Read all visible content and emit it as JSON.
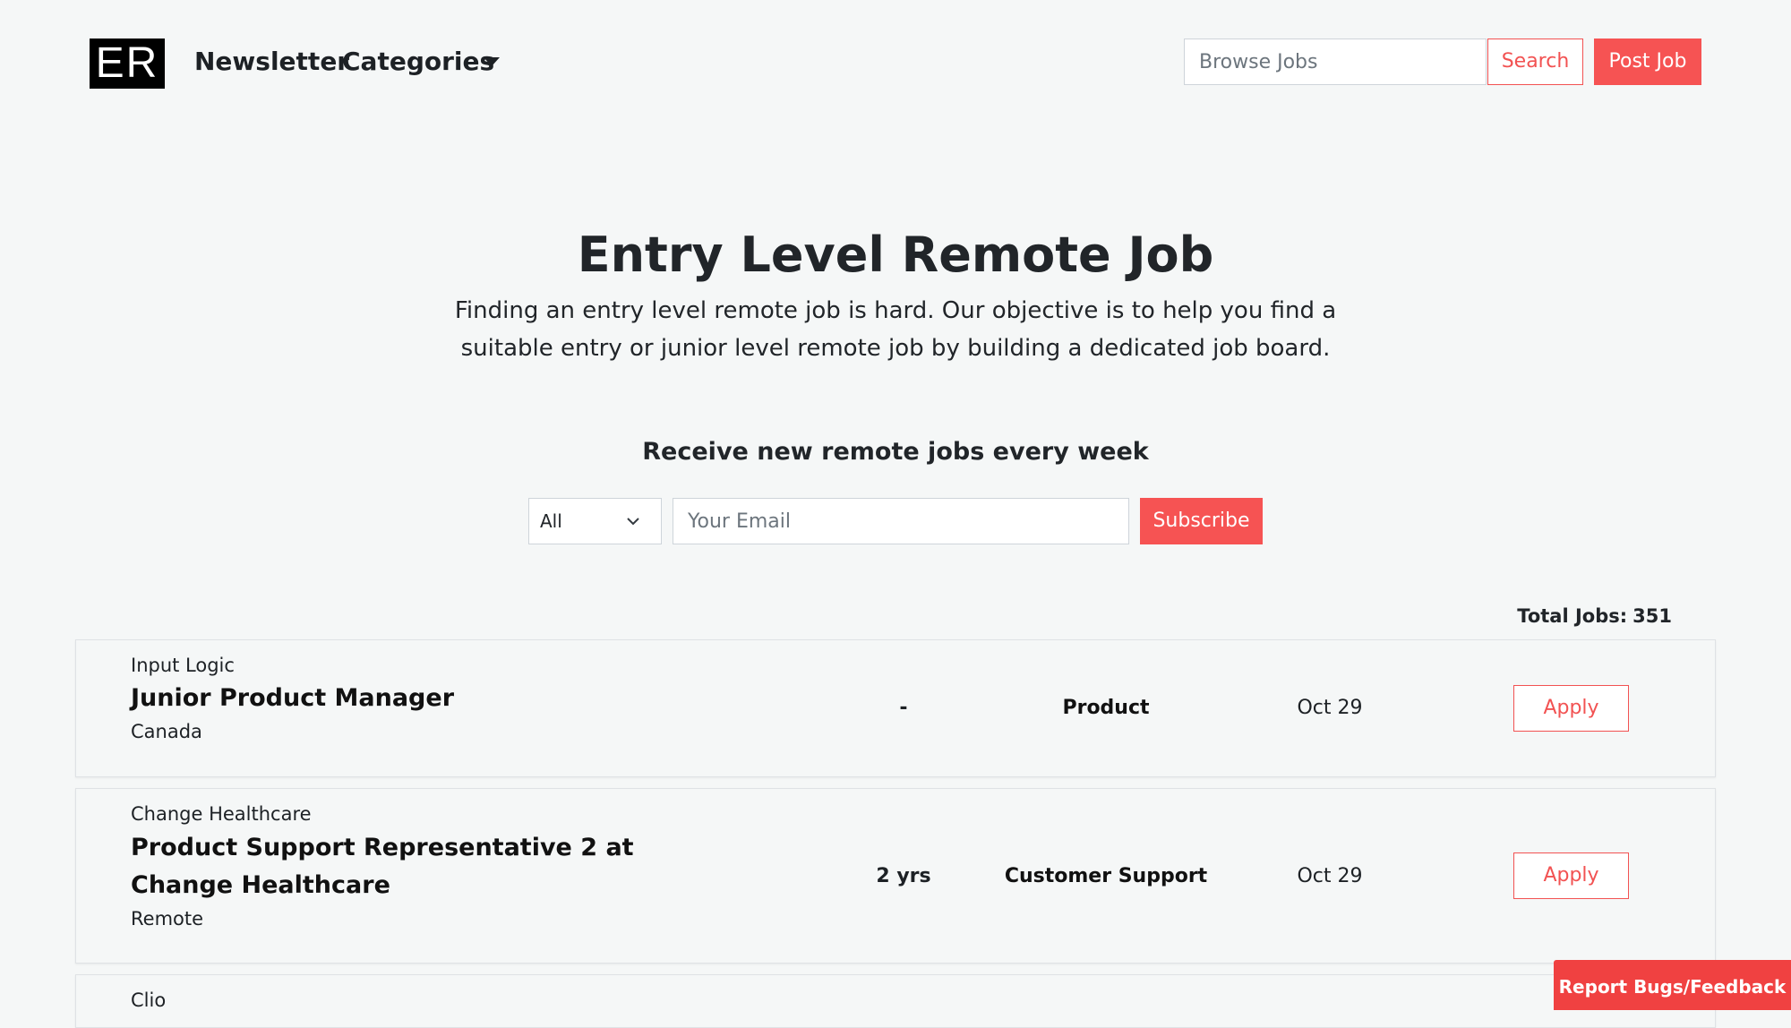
{
  "header": {
    "logo_text": "ER",
    "nav": {
      "newsletter": "Newsletter",
      "categories": "Categories"
    },
    "search": {
      "placeholder": "Browse Jobs",
      "search_label": "Search",
      "post_label": "Post Job"
    }
  },
  "hero": {
    "title": "Entry Level Remote Job",
    "description": "Finding an entry level remote job is hard. Our objective is to help you find a suitable entry or junior level remote job by building a dedicated job board."
  },
  "subscribe": {
    "heading": "Receive new remote jobs every week",
    "category_selected": "All",
    "email_placeholder": "Your Email",
    "button_label": "Subscribe"
  },
  "jobs": {
    "total_label": "Total Jobs:",
    "total_count": "351",
    "items": [
      {
        "company": "Input Logic",
        "title": "Junior Product Manager",
        "location": "Canada",
        "experience": "-",
        "category": "Product",
        "date": "Oct 29",
        "apply_label": "Apply"
      },
      {
        "company": "Change Healthcare",
        "title": "Product Support Representative 2 at Change Healthcare",
        "location": "Remote",
        "experience": "2 yrs",
        "category": "Customer Support",
        "date": "Oct 29",
        "apply_label": "Apply"
      },
      {
        "company": "Clio"
      }
    ]
  },
  "feedback": {
    "label": "Report Bugs/Feedback"
  },
  "colors": {
    "accent": "#f65353",
    "background": "#f5f7f7",
    "logo_bg": "#000000"
  },
  "icons": {
    "categories_caret": "caret-down-icon",
    "select_chevron": "chevron-down-icon"
  }
}
